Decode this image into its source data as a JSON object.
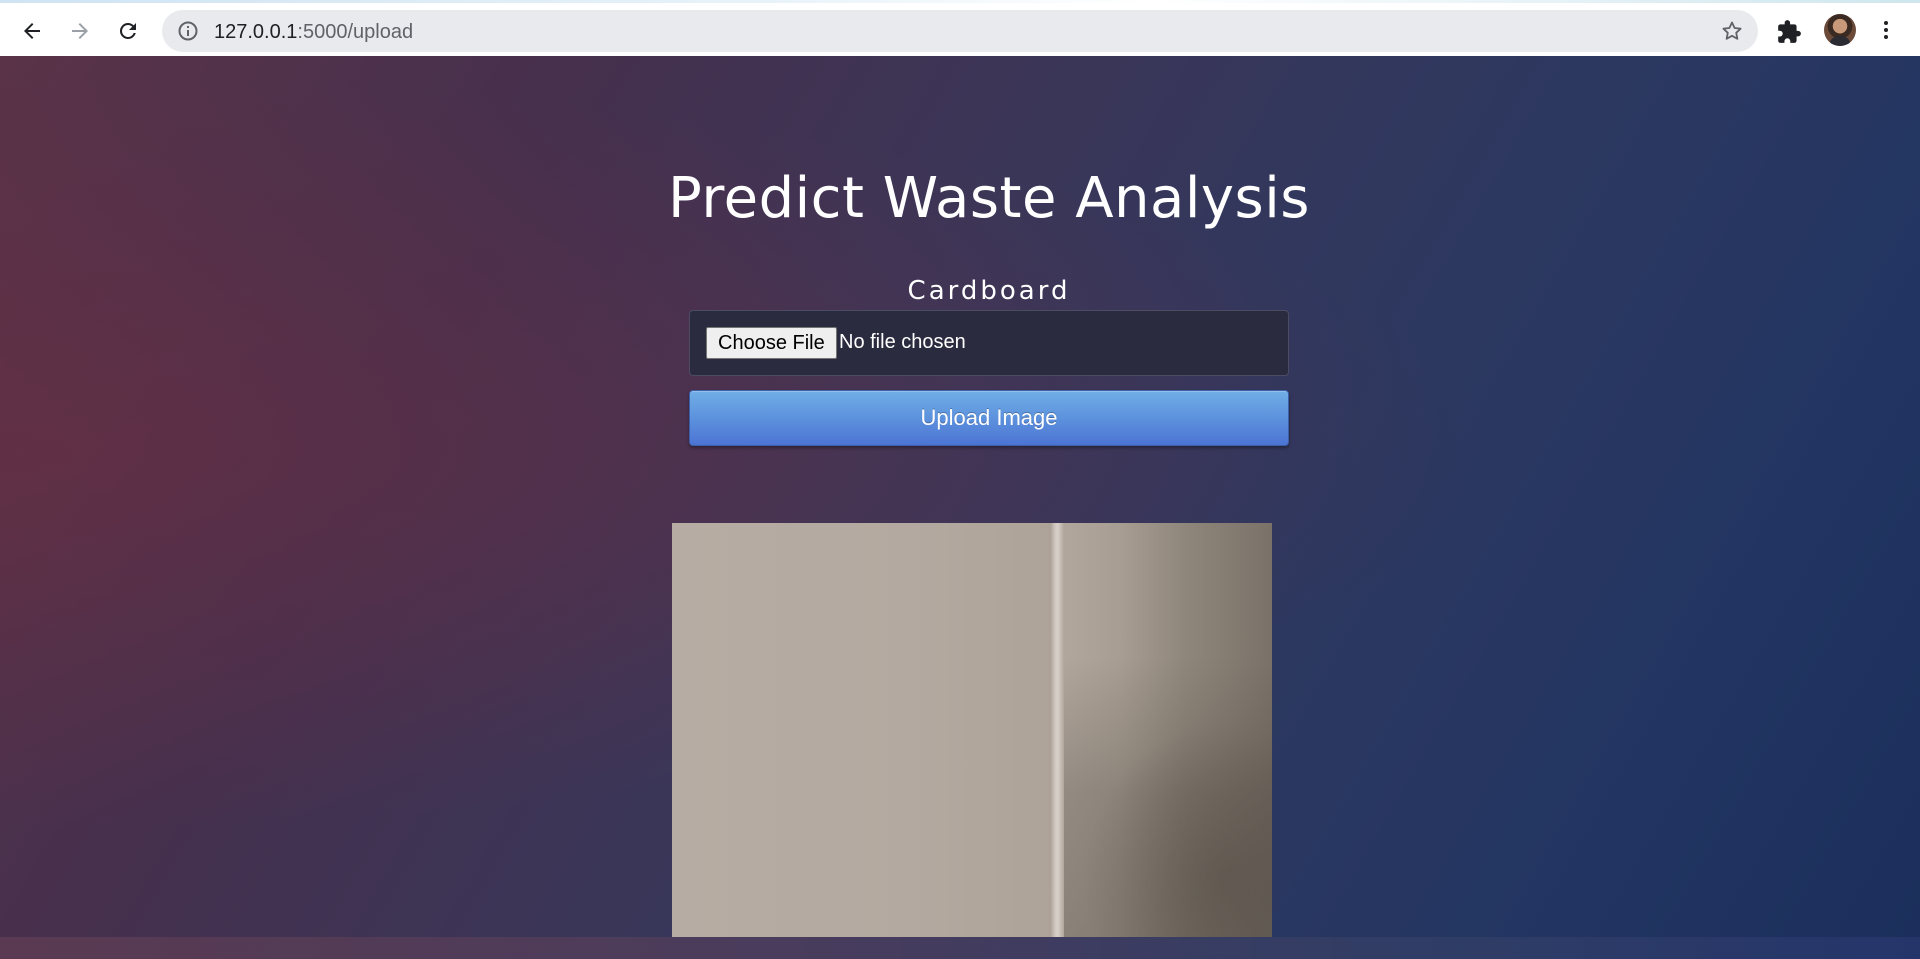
{
  "browser": {
    "url_host": "127.0.0.1",
    "url_rest": ":5000/upload"
  },
  "page": {
    "title": "Predict Waste Analysis",
    "result_label": "Cardboard",
    "file_input": {
      "button_label": "Choose File",
      "status": "No file chosen"
    },
    "upload_button": "Upload Image"
  },
  "icons": {
    "back": "back-arrow-icon",
    "forward": "forward-arrow-icon",
    "reload": "reload-icon",
    "info": "info-icon",
    "bookmark": "star-icon",
    "extensions": "puzzle-icon",
    "menu": "kebab-menu-icon"
  },
  "colors": {
    "accent_button": "#5b8fdc",
    "background_left": "#5a3348",
    "background_right": "#1c2f5c"
  }
}
